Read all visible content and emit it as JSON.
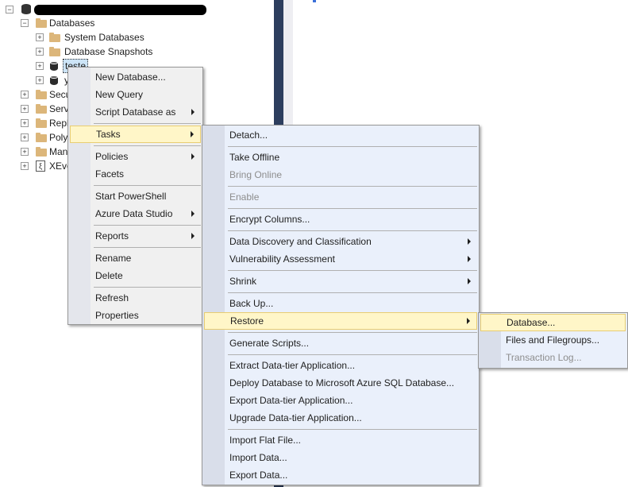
{
  "tree": {
    "server_name": "",
    "items": [
      {
        "label": "Databases",
        "expander": "−",
        "icon": "folder-icon"
      },
      {
        "label": "System Databases",
        "expander": "+",
        "icon": "folder-icon"
      },
      {
        "label": "Database Snapshots",
        "expander": "+",
        "icon": "folder-icon"
      },
      {
        "label": "teste",
        "expander": "+",
        "icon": "database-icon"
      },
      {
        "label": "y",
        "expander": "+",
        "icon": "database-icon"
      },
      {
        "label": "Secu",
        "expander": "+",
        "icon": "folder-icon"
      },
      {
        "label": "Serv",
        "expander": "+",
        "icon": "folder-icon"
      },
      {
        "label": "Repl",
        "expander": "+",
        "icon": "folder-icon"
      },
      {
        "label": "Poly",
        "expander": "+",
        "icon": "folder-icon"
      },
      {
        "label": "Man",
        "expander": "+",
        "icon": "folder-icon"
      },
      {
        "label": "XEve",
        "expander": "+",
        "icon": "xevent-icon"
      }
    ]
  },
  "context_menu": {
    "items": [
      {
        "label": "New Database..."
      },
      {
        "label": "New Query"
      },
      {
        "label": "Script Database as"
      },
      {
        "label": "Tasks"
      },
      {
        "label": "Policies"
      },
      {
        "label": "Facets"
      },
      {
        "label": "Start PowerShell"
      },
      {
        "label": "Azure Data Studio"
      },
      {
        "label": "Reports"
      },
      {
        "label": "Rename"
      },
      {
        "label": "Delete"
      },
      {
        "label": "Refresh"
      },
      {
        "label": "Properties"
      }
    ],
    "highlighted": "Tasks"
  },
  "tasks_menu": {
    "items": [
      {
        "label": "Detach..."
      },
      {
        "label": "Take Offline"
      },
      {
        "label": "Bring Online"
      },
      {
        "label": "Enable"
      },
      {
        "label": "Encrypt Columns..."
      },
      {
        "label": "Data Discovery and Classification"
      },
      {
        "label": "Vulnerability Assessment"
      },
      {
        "label": "Shrink"
      },
      {
        "label": "Back Up..."
      },
      {
        "label": "Restore"
      },
      {
        "label": "Generate Scripts..."
      },
      {
        "label": "Extract Data-tier Application..."
      },
      {
        "label": "Deploy Database to Microsoft Azure SQL Database..."
      },
      {
        "label": "Export Data-tier Application..."
      },
      {
        "label": "Upgrade Data-tier Application..."
      },
      {
        "label": "Import Flat File..."
      },
      {
        "label": "Import Data..."
      },
      {
        "label": "Export Data..."
      }
    ],
    "highlighted": "Restore",
    "disabled": [
      "Bring Online",
      "Enable"
    ]
  },
  "restore_menu": {
    "items": [
      {
        "label": "Database..."
      },
      {
        "label": "Files and Filegroups..."
      },
      {
        "label": "Transaction Log..."
      }
    ],
    "highlighted": "Database...",
    "disabled": [
      "Transaction Log..."
    ]
  },
  "colors": {
    "highlight_bg": "#fff6c8",
    "highlight_border": "#e8cd72",
    "divider": "#2d3e5e",
    "disabled_text": "#8d8d8d"
  }
}
